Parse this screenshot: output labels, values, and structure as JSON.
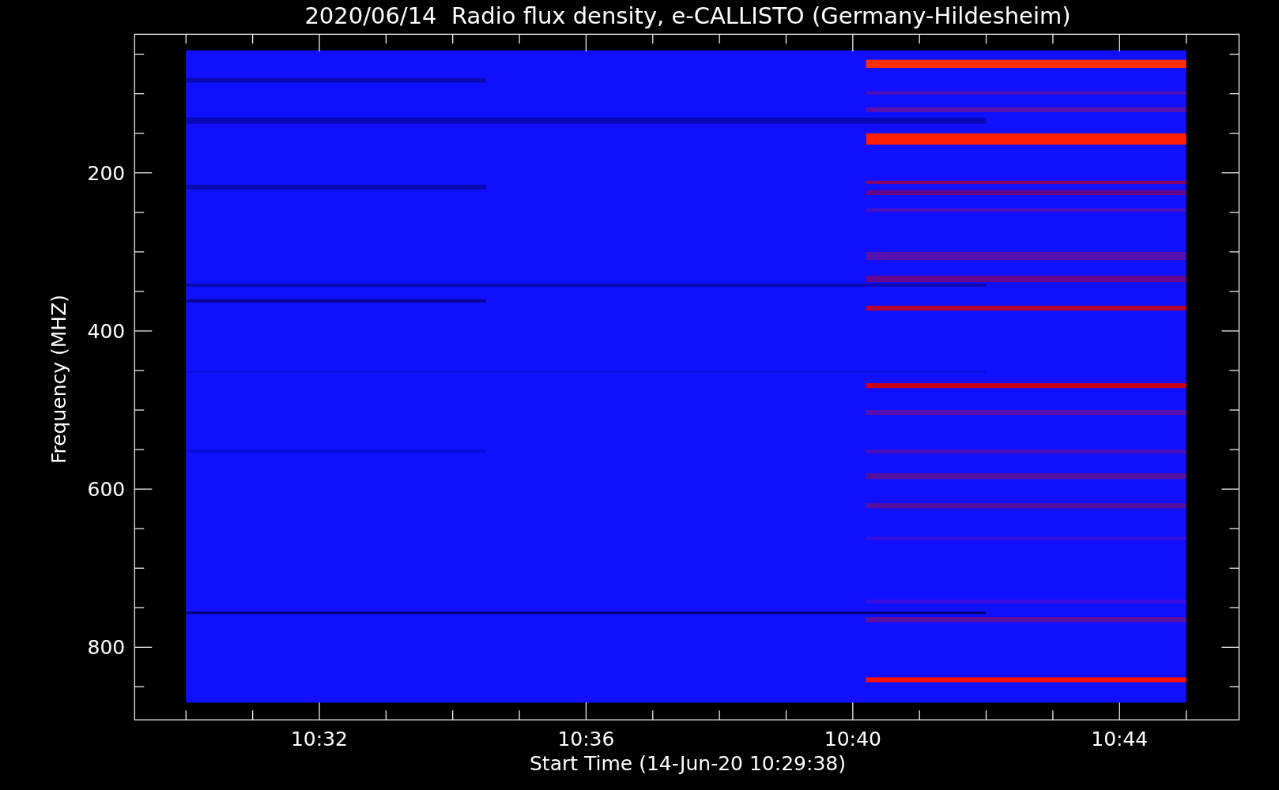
{
  "title": "2020/06/14  Radio flux density, e-CALLISTO (Germany-Hildesheim)",
  "y_axis": {
    "label": "Frequency (MHZ)",
    "tick_labels": [
      "200",
      "400",
      "600",
      "800"
    ]
  },
  "x_axis": {
    "label": "Start Time (14-Jun-20 10:29:38)",
    "tick_labels": [
      "10:32",
      "10:36",
      "10:40",
      "10:44"
    ]
  }
}
